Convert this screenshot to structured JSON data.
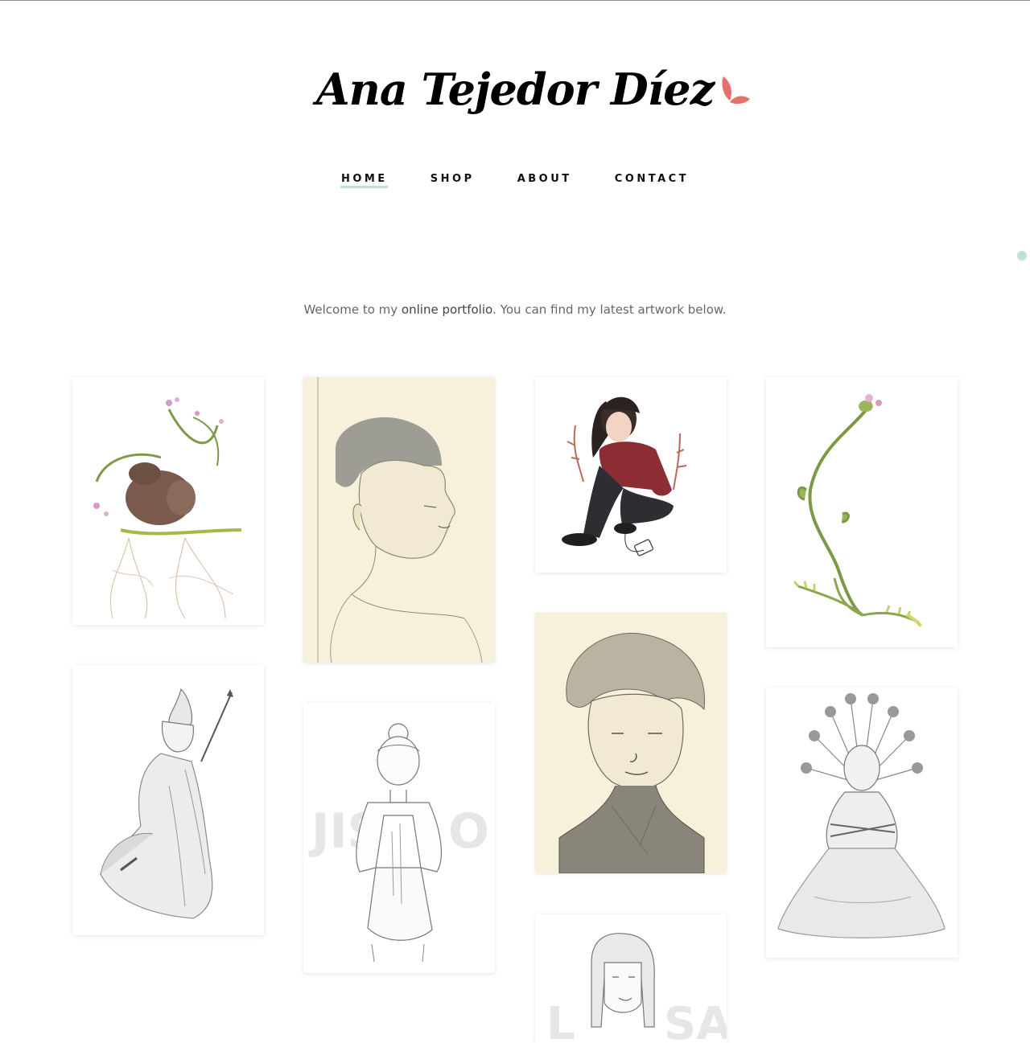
{
  "site": {
    "title": "Ana Tejedor Díez",
    "logo_icon": "leaf-logo-icon",
    "accent": "#e6706a",
    "nav_accent": "#bfe3d1"
  },
  "nav": {
    "items": [
      {
        "label": "HOME",
        "active": true
      },
      {
        "label": "SHOP"
      },
      {
        "label": "ABOUT"
      },
      {
        "label": "CONTACT"
      }
    ]
  },
  "welcome": {
    "before": "Welcome to my ",
    "link": "online portfolio",
    "after": ". You can find my latest artwork below."
  },
  "gallery": {
    "items": [
      {
        "subject": "otter-with-flowers"
      },
      {
        "subject": "pencil-portrait-man"
      },
      {
        "subject": "girl-in-red-sweater"
      },
      {
        "subject": "flower-stem"
      },
      {
        "subject": "warrior-woman-sketch"
      },
      {
        "subject": "jisoo-sketch",
        "overlay_left": "JIS",
        "overlay_right": "O"
      },
      {
        "subject": "boy-portrait-sketch"
      },
      {
        "subject": "peacock-woman-sketch"
      },
      {
        "subject": "lisa-sketch",
        "overlay_left": "L",
        "overlay_right": "SA"
      }
    ]
  }
}
